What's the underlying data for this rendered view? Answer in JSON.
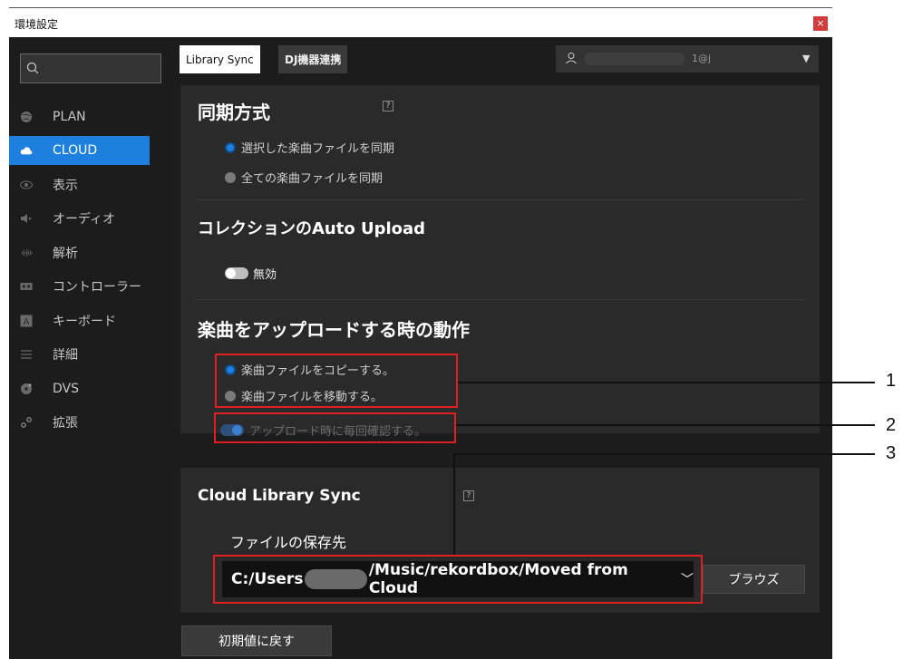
{
  "window": {
    "title": "環境設定",
    "close_label": "×"
  },
  "search": {
    "placeholder": ""
  },
  "sidebar": {
    "items": [
      {
        "label": "PLAN",
        "icon": "globe-icon"
      },
      {
        "label": "CLOUD",
        "icon": "cloud-icon",
        "active": true
      },
      {
        "label": "表示",
        "icon": "eye-icon"
      },
      {
        "label": "オーディオ",
        "icon": "speaker-icon"
      },
      {
        "label": "解析",
        "icon": "waveform-icon"
      },
      {
        "label": "コントローラー",
        "icon": "controller-icon"
      },
      {
        "label": "キーボード",
        "icon": "keyboard-icon"
      },
      {
        "label": "詳細",
        "icon": "list-icon"
      },
      {
        "label": "DVS",
        "icon": "record-icon"
      },
      {
        "label": "拡張",
        "icon": "extension-icon"
      }
    ]
  },
  "tabs": [
    {
      "label": "Library Sync",
      "active": true
    },
    {
      "label": "DJ機器連携",
      "active": false
    }
  ],
  "account": {
    "email_suffix": "1@j"
  },
  "sync_method": {
    "title": "同期方式",
    "help": "?",
    "options": [
      "選択した楽曲ファイルを同期",
      "全ての楽曲ファイルを同期"
    ],
    "selected": 0
  },
  "auto_upload": {
    "title": "コレクションのAuto Upload",
    "toggle_label": "無効"
  },
  "upload_behavior": {
    "title": "楽曲をアップロードする時の動作",
    "options": [
      "楽曲ファイルをコピーする。",
      "楽曲ファイルを移動する。"
    ],
    "selected": 0,
    "confirm_label": "アップロード時に毎回確認する。"
  },
  "cloud_library_sync": {
    "title": "Cloud Library Sync",
    "help": "?",
    "save_location_label": "ファイルの保存先",
    "path_prefix": "C:/Users",
    "path_suffix": "/Music/rekordbox/Moved from Cloud",
    "browse_label": "ブラウズ"
  },
  "reset_button": "初期値に戻す",
  "callouts": [
    "1",
    "2",
    "3"
  ],
  "colors": {
    "accent": "#1d7fde",
    "highlight_box": "#e02020"
  }
}
